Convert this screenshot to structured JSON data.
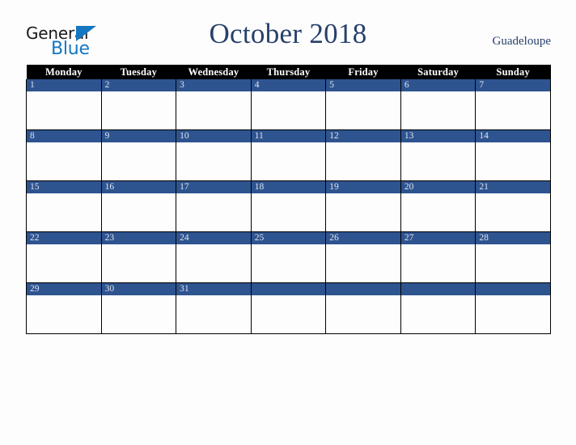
{
  "brand": {
    "name_part1": "General",
    "name_part2": "Blue",
    "triangle_icon": "triangle-right-icon",
    "primary_color": "#1577c2",
    "text_color": "#1b1b1b"
  },
  "header": {
    "title": "October 2018",
    "month": "October",
    "year": "2018",
    "region": "Guadeloupe",
    "title_color": "#27406b"
  },
  "calendar": {
    "weekday_headers": [
      "Monday",
      "Tuesday",
      "Wednesday",
      "Thursday",
      "Friday",
      "Saturday",
      "Sunday"
    ],
    "header_bg": "#000000",
    "header_text_color": "#ffffff",
    "day_band_color": "#2e5490",
    "day_number_color": "#dfe4ee",
    "cell_bg": "#fdfdfd",
    "grid_line_color": "#000000",
    "weeks": [
      [
        "1",
        "2",
        "3",
        "4",
        "5",
        "6",
        "7"
      ],
      [
        "8",
        "9",
        "10",
        "11",
        "12",
        "13",
        "14"
      ],
      [
        "15",
        "16",
        "17",
        "18",
        "19",
        "20",
        "21"
      ],
      [
        "22",
        "23",
        "24",
        "25",
        "26",
        "27",
        "28"
      ],
      [
        "29",
        "30",
        "31",
        "",
        "",
        "",
        ""
      ]
    ]
  }
}
